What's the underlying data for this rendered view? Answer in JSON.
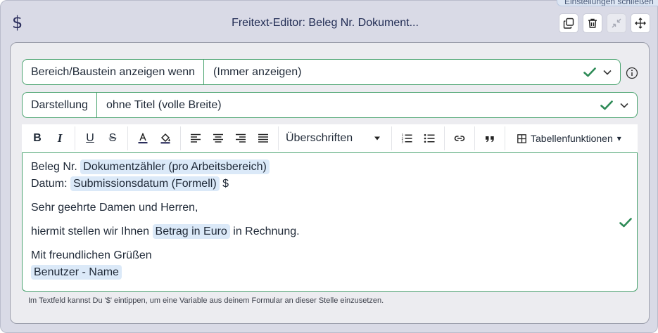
{
  "header": {
    "logo_glyph": "$",
    "title": "Freitext-Editor: Beleg Nr. Dokument...",
    "tooltip": "Einstellungen schließen",
    "buttons": [
      {
        "name": "duplicate-icon"
      },
      {
        "name": "trash-icon"
      },
      {
        "name": "collapse-icon",
        "disabled": true
      },
      {
        "name": "move-icon"
      }
    ]
  },
  "fields": {
    "visibility": {
      "label": "Bereich/Baustein anzeigen wenn",
      "value": "(Immer anzeigen)"
    },
    "display": {
      "label": "Darstellung",
      "value": "ohne Titel (volle Breite)"
    }
  },
  "toolbar": {
    "bold": "B",
    "italic": "I",
    "underline": "U",
    "strike": "S",
    "font_color": "A",
    "headings": "Überschriften",
    "table": "Tabellenfunktionen",
    "dropdown_arrow": "▾"
  },
  "editor": {
    "line1_text": "Beleg Nr.",
    "line1_chip": "Dokumentzähler (pro Arbeitsbereich)",
    "line2_text": "Datum:",
    "line2_chip": "Submissionsdatum (Formell)",
    "line2_suffix": "$",
    "salutation": "Sehr geehrte Damen und Herren,",
    "body_before": "hiermit stellen wir Ihnen",
    "body_chip": "Betrag in Euro",
    "body_after": "in Rechnung.",
    "closing": "Mit freundlichen Grüßen",
    "closing_chip": "Benutzer - Name"
  },
  "hint": "Im Textfeld kannst Du '$' eintippen, um eine Variable aus deinem Formular an dieser Stelle einzusetzen.",
  "colors": {
    "accent_green": "#2e8b57",
    "chip_bg": "#dbe9f8",
    "dialog_bg": "#d9dae6"
  }
}
